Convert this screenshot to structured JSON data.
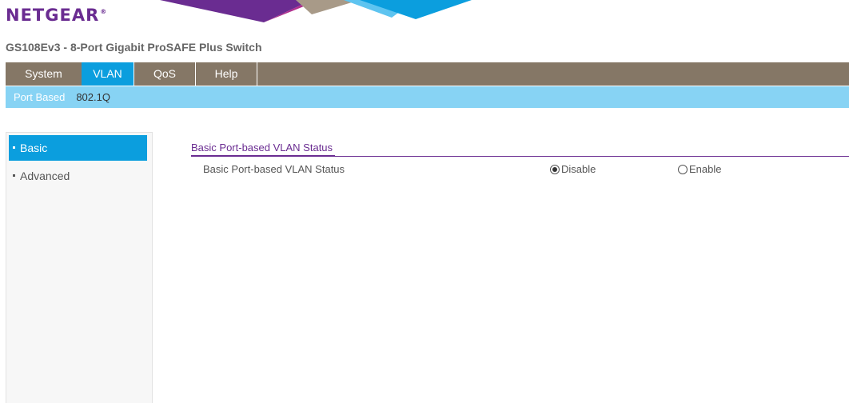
{
  "brand": {
    "logo_text": "NETGEAR"
  },
  "product": {
    "title": "GS108Ev3 - 8-Port Gigabit ProSAFE Plus Switch"
  },
  "main_tabs": [
    {
      "label": "System"
    },
    {
      "label": "VLAN",
      "active": true
    },
    {
      "label": "QoS"
    },
    {
      "label": "Help"
    }
  ],
  "sub_tabs": [
    {
      "label": "Port Based",
      "active": true
    },
    {
      "label": "802.1Q"
    }
  ],
  "sidebar": {
    "items": [
      {
        "label": "Basic",
        "active": true
      },
      {
        "label": "Advanced"
      }
    ]
  },
  "content": {
    "section_title": "Basic Port-based VLAN Status",
    "field_label": "Basic Port-based VLAN Status",
    "options": [
      {
        "label": "Disable",
        "checked": true
      },
      {
        "label": "Enable",
        "checked": false
      }
    ]
  },
  "colors": {
    "brand_purple": "#6a2c91",
    "tab_bar": "#857766",
    "active_blue": "#0b9ede",
    "sub_tab_bar": "#87d3f4"
  }
}
